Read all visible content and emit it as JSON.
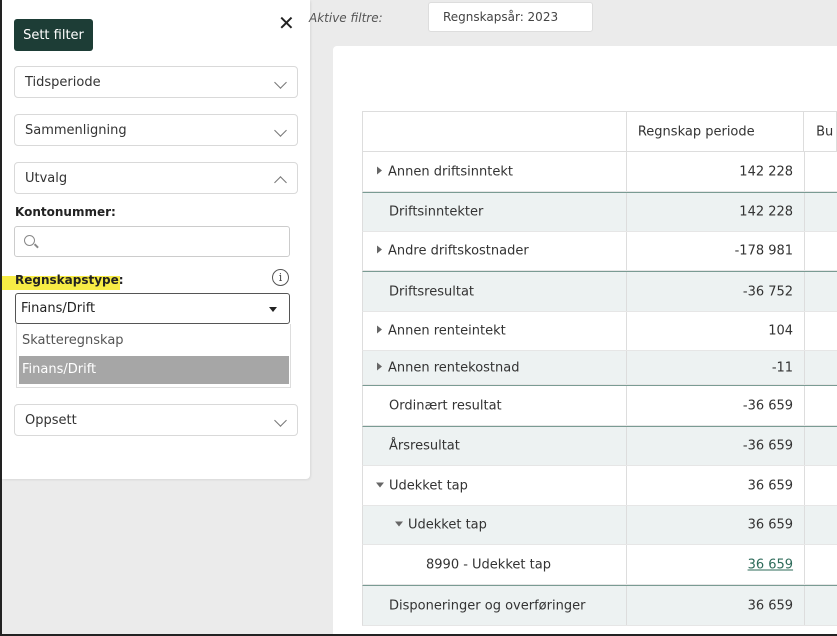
{
  "filter_panel": {
    "button_label": "Sett filter",
    "close_glyph": "✕",
    "accordions": {
      "tidsperiode": "Tidsperiode",
      "sammenligning": "Sammenligning",
      "utvalg": "Utvalg",
      "oppsett": "Oppsett"
    },
    "kontonummer_label": "Kontonummer:",
    "search_placeholder": "",
    "regnskapstype_label": "Regnskapstype:",
    "info_glyph": "i",
    "regnskapstype_value": "Finans/Drift",
    "options": [
      "Skatteregnskap",
      "Finans/Drift"
    ]
  },
  "active_filters": {
    "label": "Aktive filtre:",
    "chips": [
      "Regnskapsår: 2023"
    ]
  },
  "table": {
    "headers": [
      "",
      "Regnskap periode",
      "Bu"
    ],
    "rows": [
      {
        "label": "Annen driftsinntekt",
        "value": "142 228"
      },
      {
        "label": "Driftsinntekter",
        "value": "142 228"
      },
      {
        "label": "Andre driftskostnader",
        "value": "-178 981"
      },
      {
        "label": "Driftsresultat",
        "value": "-36 752"
      },
      {
        "label": "Annen renteintekt",
        "value": "104"
      },
      {
        "label": "Annen rentekostnad",
        "value": "-11"
      },
      {
        "label": "Ordinært resultat",
        "value": "-36 659"
      },
      {
        "label": "Årsresultat",
        "value": "-36 659"
      },
      {
        "label": "Udekket tap",
        "value": "36 659"
      },
      {
        "label": "Udekket tap",
        "value": "36 659"
      },
      {
        "label": "8990 - Udekket tap",
        "value": "36 659"
      },
      {
        "label": "Disponeringer og overføringer",
        "value": "36 659"
      }
    ]
  },
  "colors": {
    "primary_button": "#1d3d36",
    "highlight": "#f7ec45",
    "row_alt": "#edf2f2",
    "selected_option": "#a6a6a6"
  }
}
